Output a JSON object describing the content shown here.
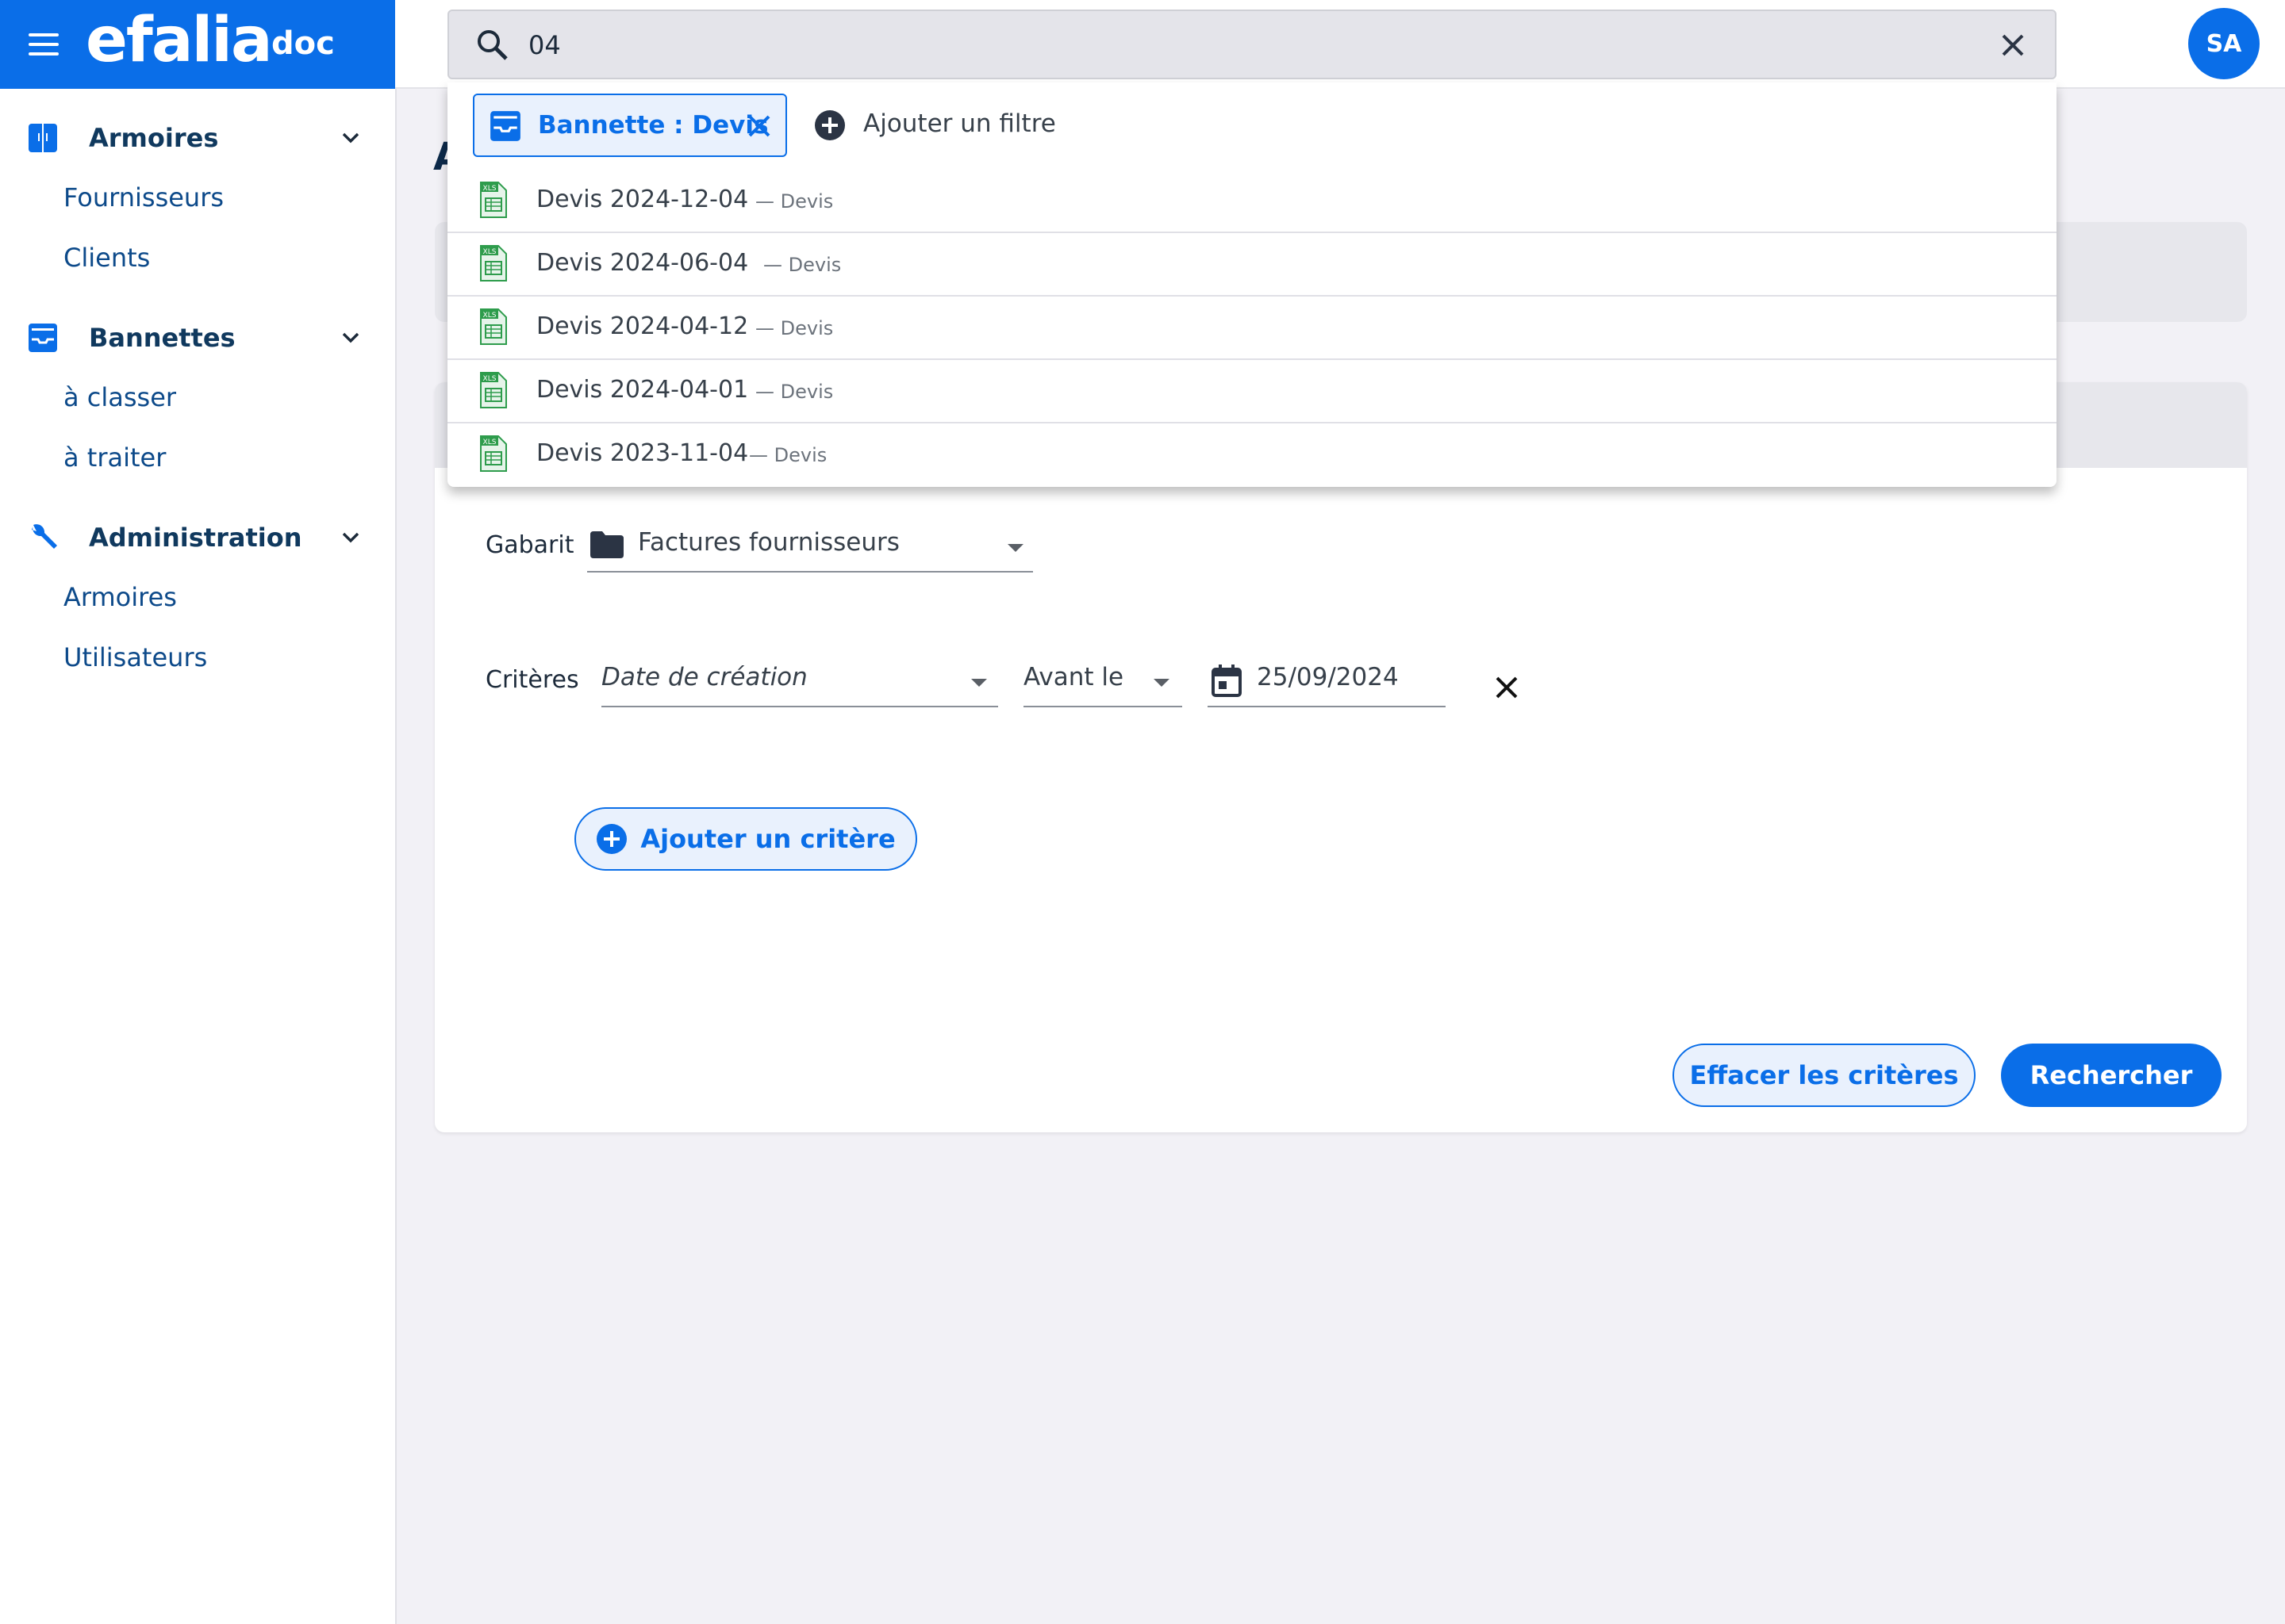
{
  "brand": {
    "logo": "efalia",
    "sub": "doc"
  },
  "search": {
    "value": "04"
  },
  "user": {
    "initials": "SA"
  },
  "dropdown": {
    "chip_label": "Bannette : Devis",
    "add_filter_label": "Ajouter un filtre",
    "results": [
      {
        "name": "Devis 2024-12-04",
        "tag": "— Devis"
      },
      {
        "name": "Devis 2024-06-04",
        "tag": "— Devis"
      },
      {
        "name": "Devis 2024-04-12",
        "tag": "— Devis"
      },
      {
        "name": "Devis 2024-04-01",
        "tag": "— Devis"
      },
      {
        "name": "Devis 2023-11-04",
        "tag": "— Devis"
      }
    ]
  },
  "sidebar": {
    "sections": [
      {
        "label": "Armoires",
        "items": [
          "Fournisseurs",
          "Clients"
        ]
      },
      {
        "label": "Bannettes",
        "items": [
          "à classer",
          "à traiter"
        ]
      },
      {
        "label": "Administration",
        "items": [
          "Armoires",
          "Utilisateurs"
        ]
      }
    ]
  },
  "main": {
    "title_peek": "A",
    "gabarit_label": "Gabarit",
    "gabarit_value": "Factures fournisseurs",
    "criteres_label": "Critères",
    "criteria_field": "Date de création",
    "criteria_op": "Avant le",
    "criteria_date": "25/09/2024",
    "add_criteria_label": "Ajouter un critère",
    "clear_label": "Effacer les critères",
    "search_label": "Rechercher"
  },
  "colors": {
    "accent": "#0a6ee8",
    "background": "#f2f1f6",
    "xls_green": "#2e9c4c"
  }
}
